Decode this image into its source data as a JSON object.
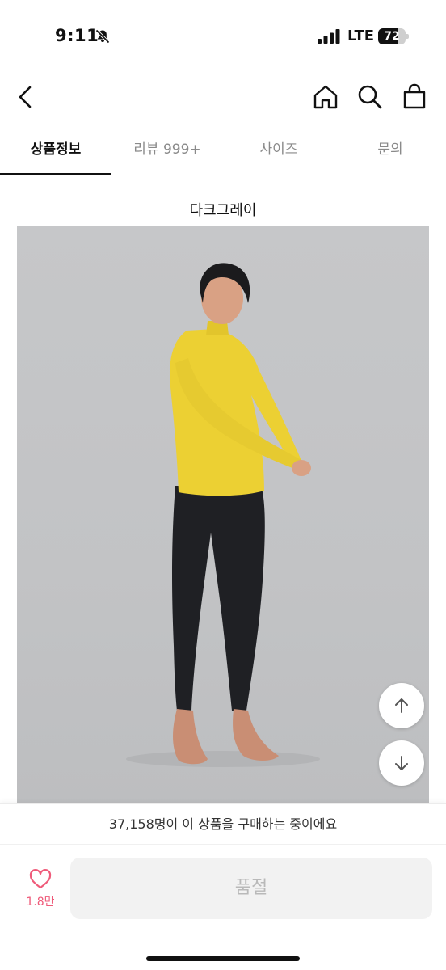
{
  "status_bar": {
    "time": "9:11",
    "network": "LTE",
    "battery": "72",
    "battery_level": 0.72,
    "icons": [
      "bell-muted-icon",
      "signal-icon"
    ]
  },
  "nav": {
    "icons": [
      "back-arrow-icon",
      "home-icon",
      "search-icon",
      "shopping-bag-icon"
    ]
  },
  "tabs": [
    {
      "label": "상품정보",
      "active": true
    },
    {
      "label": "리뷰 999+",
      "active": false
    },
    {
      "label": "사이즈",
      "active": false
    },
    {
      "label": "문의",
      "active": false
    }
  ],
  "content": {
    "color_caption": "다크그레이",
    "image_subject": "model-photo"
  },
  "scroll_buttons": {
    "icons": [
      "arrow-up-icon",
      "arrow-down-icon"
    ]
  },
  "purchase_banner": "37,158명이 이 상품을 구매하는 중이에요",
  "bottom_bar": {
    "like_count": "1.8만",
    "soldout_label": "품절",
    "accent_color": "#ef5b7a"
  }
}
